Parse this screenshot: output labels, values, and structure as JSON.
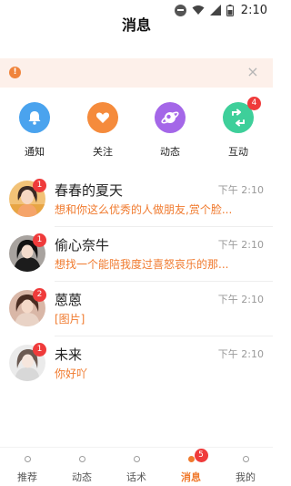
{
  "status_bar": {
    "time": "2:10"
  },
  "header": {
    "title": "消息"
  },
  "notice": {
    "icon": "!",
    "close_icon": "×"
  },
  "quick_entries": [
    {
      "label": "通知",
      "icon": "bell-icon",
      "color": "#4aa3ee"
    },
    {
      "label": "关注",
      "icon": "heart-icon",
      "color": "#f58b3c"
    },
    {
      "label": "动态",
      "icon": "planet-icon",
      "color": "#a467e8"
    },
    {
      "label": "互动",
      "icon": "interact-icon",
      "color": "#3ecf9a",
      "badge": "4"
    }
  ],
  "messages": [
    {
      "name": "春春的夏天",
      "time": "下午 2:10",
      "preview": "想和你这么优秀的人做朋友,赏个脸...",
      "badge": "1"
    },
    {
      "name": "偷心奈牛",
      "time": "下午 2:10",
      "preview": "想找一个能陪我度过喜怒哀乐的那...",
      "badge": "1"
    },
    {
      "name": "蒽蒽",
      "time": "下午 2:10",
      "preview": "[图片]",
      "badge": "2"
    },
    {
      "name": "未来",
      "time": "下午 2:10",
      "preview": "你好吖",
      "badge": "1"
    }
  ],
  "tabbar": {
    "tabs": [
      {
        "label": "推荐"
      },
      {
        "label": "动态"
      },
      {
        "label": "话术"
      },
      {
        "label": "消息",
        "active": true,
        "badge": "5"
      },
      {
        "label": "我的"
      }
    ]
  },
  "colors": {
    "accent": "#f07a2e",
    "badge": "#ef3b3b",
    "notice_bg": "#fdf0ea"
  }
}
